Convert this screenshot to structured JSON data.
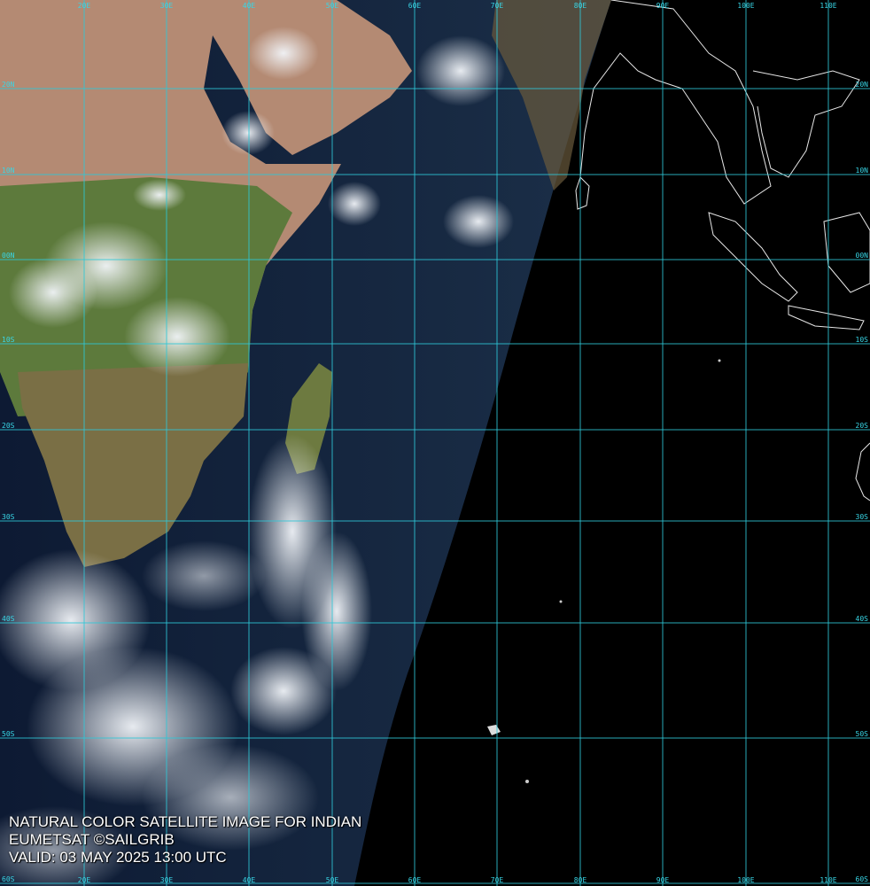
{
  "caption": {
    "line1": "NATURAL COLOR SATELLITE IMAGE FOR INDIAN",
    "line2": "EUMETSAT ©SAILGRIB",
    "line3": "VALID:  03 MAY 2025 13:00 UTC"
  },
  "longitude_labels": [
    "20E",
    "30E",
    "40E",
    "50E",
    "60E",
    "70E",
    "80E",
    "90E",
    "100E",
    "110E"
  ],
  "latitude_labels": [
    "20N",
    "10N",
    "00N",
    "10S",
    "20S",
    "30S",
    "40S",
    "50S",
    "60S"
  ],
  "colors": {
    "grid": "#2ec8d8",
    "land_desert": "#b88a74",
    "land_vegetation": "#5f7a3c",
    "ocean_day": "#101a30",
    "night": "#000000",
    "cloud": "#e8ecf2"
  }
}
